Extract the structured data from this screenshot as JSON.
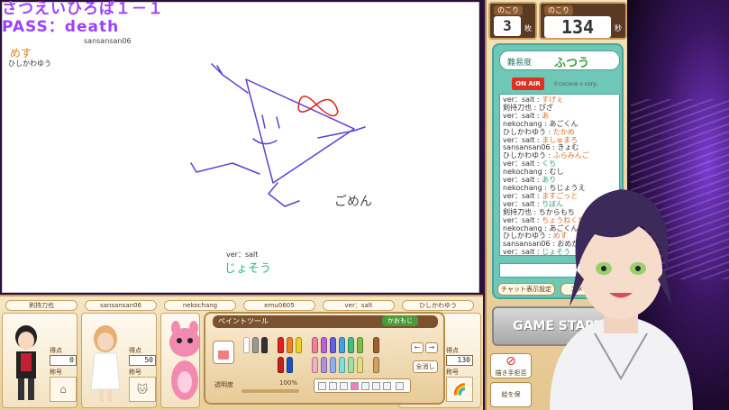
{
  "overlay": {
    "title": "さつえいひろば１－１",
    "pass": "PASS：death"
  },
  "canvas": {
    "drawer_name": "sansansan06",
    "answers": [
      {
        "user": "ひしかわゆう",
        "text": "めす"
      },
      {
        "user": "ver：salt",
        "text": "じょそう"
      }
    ],
    "drawing_text": "ごめん"
  },
  "players": [
    {
      "name": "剣持刀也",
      "score": "0",
      "score_label": "得点",
      "title_label": "称号"
    },
    {
      "name": "sansansan06",
      "score": "50",
      "score_label": "得点",
      "title_label": "称号"
    },
    {
      "name": "nekochang"
    },
    {
      "name": "emu0605"
    },
    {
      "name": "ver：salt"
    },
    {
      "name": "ひしかわゆう",
      "score": "130",
      "score_label": "得点",
      "title_label": "称号"
    }
  ],
  "painttool": {
    "header": "ペイントツール",
    "kaomoji_button": "かおもじ",
    "clear_button": "全消し",
    "opacity_label": "透明度",
    "opacity_value": "100%"
  },
  "counters": {
    "remaining_label": "のこり",
    "remaining_count": "3",
    "remaining_unit": "枚",
    "time_label": "のこり",
    "time_value": "134",
    "time_unit": "秒"
  },
  "chat": {
    "difficulty_label": "難易度",
    "difficulty_value": "ふつう",
    "onair": "ON AIR",
    "copyright": "©cocone v corp.",
    "lines": [
      {
        "user": "ver：salt",
        "msg": "すげぇ",
        "color": "orange"
      },
      {
        "user": "剣持刀也",
        "msg": "ぴざ",
        "color": "plain"
      },
      {
        "user": "ver：salt",
        "msg": "あ",
        "color": "orange"
      },
      {
        "user": "nekochang",
        "msg": "あごくん",
        "color": "plain"
      },
      {
        "user": "ひしかわゆう",
        "msg": "たかめ",
        "color": "orange"
      },
      {
        "user": "ver：salt",
        "msg": "ましゅまろ",
        "color": "orange"
      },
      {
        "user": "sansansan06",
        "msg": "きょむ",
        "color": "plain"
      },
      {
        "user": "ひしかわゆう",
        "msg": "ふらみんご",
        "color": "orange"
      },
      {
        "user": "ver：salt",
        "msg": "くち",
        "color": "green"
      },
      {
        "user": "nekochang",
        "msg": "むし",
        "color": "plain"
      },
      {
        "user": "ver：salt",
        "msg": "あり",
        "color": "green"
      },
      {
        "user": "nekochang",
        "msg": "ちじょうえ",
        "color": "plain"
      },
      {
        "user": "ver：salt",
        "msg": "ますごっと",
        "color": "orange"
      },
      {
        "user": "ver：salt",
        "msg": "りぼん",
        "color": "green"
      },
      {
        "user": "剣持刀也",
        "msg": "ちからもち",
        "color": "plain"
      },
      {
        "user": "ver：salt",
        "msg": "ちょうねくたい",
        "color": "orange"
      },
      {
        "user": "nekochang",
        "msg": "あごくんち",
        "color": "plain"
      },
      {
        "user": "ひしかわゆう",
        "msg": "めす",
        "color": "orange"
      },
      {
        "user": "sansansan06",
        "msg": "おめかし",
        "color": "plain"
      },
      {
        "user": "ver：salt",
        "msg": "じょそう",
        "color": "green"
      }
    ],
    "display_settings_button": "チャット表示設定",
    "comment_button": "コメント"
  },
  "game": {
    "start_button": "GAME START",
    "draw_button": "描き手拒否",
    "picture_button": "絵を保"
  }
}
